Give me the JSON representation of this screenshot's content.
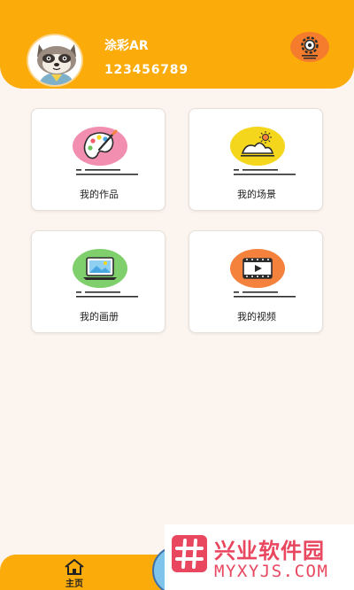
{
  "profile": {
    "username": "涂彩AR",
    "user_id": "123456789",
    "avatar_icon": "raccoon-avatar"
  },
  "settings_icon": "gear-icon",
  "grid": [
    {
      "label": "我的作品",
      "icon": "palette-icon",
      "icon_bg": "#f28fb0"
    },
    {
      "label": "我的场景",
      "icon": "scene-icon",
      "icon_bg": "#f4d61c"
    },
    {
      "label": "我的画册",
      "icon": "laptop-picture-icon",
      "icon_bg": "#7fcf6d"
    },
    {
      "label": "我的视频",
      "icon": "video-icon",
      "icon_bg": "#f4823c"
    }
  ],
  "bottom_nav": {
    "home_label": "主页",
    "home_icon": "home-icon"
  },
  "watermark": {
    "title": "兴业软件园",
    "url": "MYXYJS.COM"
  },
  "colors": {
    "brand": "#fbab0a",
    "background": "#fcf4ee",
    "watermark": "#e8475f"
  }
}
